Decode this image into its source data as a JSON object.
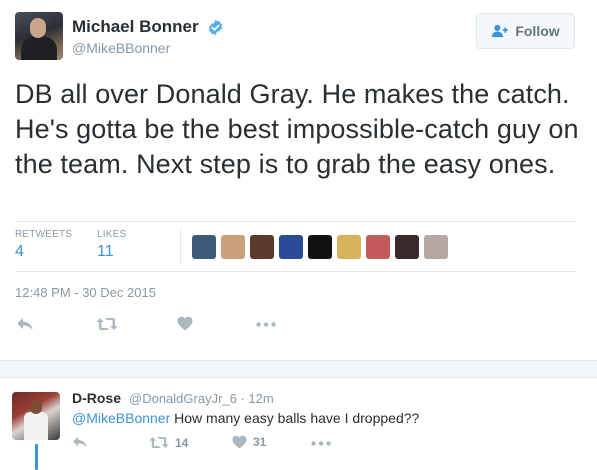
{
  "tweet": {
    "author": {
      "name": "Michael Bonner",
      "handle": "@MikeBBonner",
      "verified": true
    },
    "follow_label": "Follow",
    "text": "DB all over Donald Gray. He makes the catch. He's gotta be the best impossible-catch guy on the team. Next step is to grab the easy ones.",
    "stats": {
      "retweets_label": "RETWEETS",
      "retweets_value": "4",
      "likes_label": "LIKES",
      "likes_value": "11"
    },
    "likers": [
      {
        "name": "liker-avatar-1",
        "color": "#3d5a7a"
      },
      {
        "name": "liker-avatar-2",
        "color": "#c9a07a"
      },
      {
        "name": "liker-avatar-3",
        "color": "#5a3a2a"
      },
      {
        "name": "liker-avatar-4",
        "color": "#2a4a9a"
      },
      {
        "name": "liker-avatar-5",
        "color": "#111111"
      },
      {
        "name": "liker-avatar-6",
        "color": "#d6b25a"
      },
      {
        "name": "liker-avatar-7",
        "color": "#c55a5a"
      },
      {
        "name": "liker-avatar-8",
        "color": "#3a2a2a"
      },
      {
        "name": "liker-avatar-9",
        "color": "#b7a7a3"
      }
    ],
    "timestamp": "12:48 PM - 30 Dec 2015",
    "actions": [
      "reply-icon",
      "retweet-icon",
      "like-icon",
      "more-icon"
    ]
  },
  "reply": {
    "author_name": "D-Rose",
    "author_handle": "@DonaldGrayJr_6 · 12m",
    "mention": "@MikeBBonner",
    "text": " How many easy balls have I dropped??",
    "retweet_count": "14",
    "like_count": "31"
  },
  "colors": {
    "link": "#3b94d9",
    "muted": "#8899a6",
    "icon": "#aab8c2",
    "verified": "#55acee",
    "text": "#292f33"
  }
}
